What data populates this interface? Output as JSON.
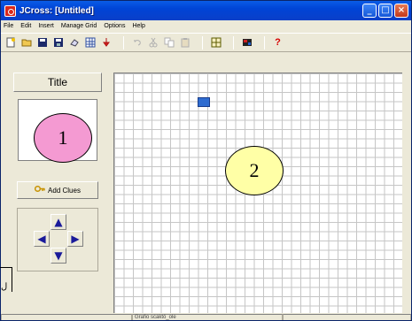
{
  "window": {
    "title": "JCross: [Untitled]",
    "minimize": "_",
    "maximize": "□",
    "close": "×"
  },
  "menu": [
    "File",
    "Edit",
    "Insert",
    "Manage Grid",
    "Options",
    "Help"
  ],
  "toolbar": {
    "icons": [
      "new-icon",
      "open-icon",
      "save-icon",
      "save-as-icon",
      "erase-icon",
      "grid-icon",
      "marker-icon",
      "undo-icon",
      "cut-icon",
      "copy-icon",
      "paste-icon",
      "grid-size-icon",
      "web-page-icon",
      "help-icon"
    ],
    "help_label": "?"
  },
  "left_panel": {
    "title_button": "Title",
    "add_clues": "Add Clues",
    "arrows": {
      "up": "▲",
      "left": "◀",
      "right": "▶",
      "down": "▼"
    }
  },
  "annotations": {
    "one": "1",
    "two": "2"
  },
  "bracket_glyph": "ل",
  "status": [
    "",
    "Grafio scaktó_ole",
    ""
  ],
  "colors": {
    "title_bar": "#0044d6",
    "grid_line": "#c6c6c6",
    "cursor_cell": "#2f6cd0",
    "annotation_one": "#f49ad2",
    "annotation_two": "#ffffa6"
  }
}
